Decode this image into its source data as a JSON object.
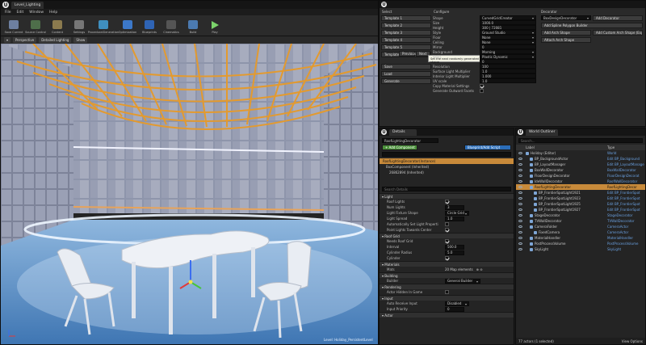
{
  "editor": {
    "tab": "Level_Lighting",
    "menu": [
      "File",
      "Edit",
      "Window",
      "Help"
    ],
    "toolbar": [
      "Save Current",
      "Source Control",
      "Content",
      "Settings",
      "ProceduralGeneration",
      "Optimization",
      "Blueprints",
      "Cinematics",
      "Build",
      "Play"
    ],
    "viewport": {
      "buttons": [
        "Perspective",
        "Detailed Lighting",
        "Show"
      ]
    },
    "watermark": "Level: Holiday_PersistentLevel"
  },
  "generator": {
    "select_header": "Select",
    "configure_header": "Configure",
    "decorate_header": "Decorator",
    "templates": [
      "Template 1",
      "Template 2",
      "Template 3",
      "Template 4",
      "Template 5",
      "Template 6"
    ],
    "nav": [
      "Previous",
      "Next"
    ],
    "actions": [
      "Save",
      "Load",
      "Generate"
    ],
    "tooltip": "Set the next randomly generated shape",
    "config_rows": [
      {
        "label": "Shape",
        "value": "CurvedGridCreator"
      },
      {
        "label": "Size",
        "value": "1000.0"
      },
      {
        "label": "Height",
        "value": "300 | 72081"
      },
      {
        "label": "Style",
        "value": "Ground Studio"
      },
      {
        "label": "Floor",
        "value": "None"
      },
      {
        "label": "Ceiling",
        "value": "None"
      },
      {
        "label": "Mirror",
        "value": "0"
      },
      {
        "label": "Background",
        "value": "Morning"
      }
    ],
    "config_rows_2": [
      {
        "label": "Walls",
        "value": "Plastic Dynamic"
      },
      {
        "label": "",
        "value": "0"
      },
      {
        "label": "Resolution",
        "value": "100"
      },
      {
        "label": "Surface Light Multiplier",
        "value": "1.0"
      },
      {
        "label": "Interior Light Multiplier",
        "value": "1.000"
      },
      {
        "label": "UV scale",
        "value": "1.0"
      }
    ],
    "checks": [
      "Copy Material Settings",
      "Generate Outward Facets"
    ],
    "decorator_value": "BoxDesignDecorator",
    "decorator_buttons": [
      "Add Decorator",
      "Add Spline Polygon Builder",
      "Add Arch Shape",
      "Add Custom Arch Shape (Experimen...)",
      "Attach Arch Shape"
    ]
  },
  "details": {
    "tab": "Details",
    "name": "RoofLightingDecorator",
    "add_component": "+ Add Component",
    "blueprint": "Blueprint/Add Script",
    "components": [
      "RoofLightingDecorator(Instance)",
      "BoxComponent (Inherited)",
      "26862894 (Inherited)"
    ],
    "search_placeholder": "Search Details",
    "sections": {
      "light": "Light",
      "roof": "Roof Grid",
      "materials": "Materials",
      "building": "Building",
      "rendering": "Rendering",
      "input": "Input",
      "actor": "Actor"
    },
    "light_rows": [
      {
        "label": "Roof Lights",
        "on": true
      },
      {
        "label": "Num Lights",
        "value": "3"
      },
      {
        "label": "Light Fixture Shape",
        "value": "Circle Grid"
      },
      {
        "label": "Light Spread",
        "value": "1.0"
      },
      {
        "label": "Automatically Set Light Properti",
        "on": false
      },
      {
        "label": "Point Lights Towards Center",
        "on": true
      }
    ],
    "roof_rows": [
      {
        "label": "Needs Roof Grid",
        "on": true
      },
      {
        "label": "Interval",
        "value": "500.0"
      },
      {
        "label": "Cylinder Radius",
        "value": "5.0"
      },
      {
        "label": "Cylinder",
        "on": true
      }
    ],
    "materials_row": {
      "label": "Mats",
      "value": "20 Map elements"
    },
    "building_row": {
      "label": "Builder",
      "value": "General Builder"
    },
    "rendering_row": {
      "label": "Actor Hidden In Game",
      "on": false
    },
    "input_rows": [
      {
        "label": "Auto Receive Input",
        "value": "Disabled"
      },
      {
        "label": "Input Priority",
        "value": "0"
      }
    ]
  },
  "outliner": {
    "tab": "World Outliner",
    "search_placeholder": "Search...",
    "col_label": "Label",
    "col_type": "Type",
    "rows": [
      {
        "label": "Holiday (Editor)",
        "type": "World",
        "depth": 0
      },
      {
        "label": "BP_BackgroundActor",
        "type": "Edit BP_Background",
        "depth": 1
      },
      {
        "label": "BP_LayoutManager",
        "type": "Edit BP_LayoutManage",
        "depth": 1
      },
      {
        "label": "BoxWallDecorator",
        "type": "BoxWallDecorator",
        "depth": 1
      },
      {
        "label": "FloorDesignDecorator",
        "type": "FloorDesignDecorat",
        "depth": 1
      },
      {
        "label": "IdeWallDecorator",
        "type": "RoofWallDecorator",
        "depth": 1
      },
      {
        "label": "RoofLightingDecorator",
        "type": "RoofLightingDecor",
        "depth": 1,
        "selected": true
      },
      {
        "label": "BP_FrontierSpotLight1921",
        "type": "Edit BP_FrontierSpot",
        "depth": 2
      },
      {
        "label": "BP_FrontierSpotLight1923",
        "type": "Edit BP_FrontierSpot",
        "depth": 2
      },
      {
        "label": "BP_FrontierSpotLight1925",
        "type": "Edit BP_FrontierSpot",
        "depth": 2
      },
      {
        "label": "BP_FrontierSpotLight1927",
        "type": "Edit BP_FrontierSpot",
        "depth": 2
      },
      {
        "label": "StageDecorator",
        "type": "StageDecorator",
        "depth": 1
      },
      {
        "label": "TVWallDecorator",
        "type": "TVWallDecorator",
        "depth": 1
      },
      {
        "label": "CameraFolder",
        "type": "CameraActor",
        "depth": 1
      },
      {
        "label": "FixedCamera",
        "type": "CameraActor",
        "depth": 2
      },
      {
        "label": "MaterialHandler",
        "type": "MaterialHandler",
        "depth": 1
      },
      {
        "label": "PostProcessVolume",
        "type": "PostProcessVolume",
        "depth": 1
      },
      {
        "label": "SkyLight",
        "type": "SkyLight",
        "depth": 1
      }
    ],
    "footer": "77 actors (1 selected)",
    "view_options": "View Options"
  }
}
